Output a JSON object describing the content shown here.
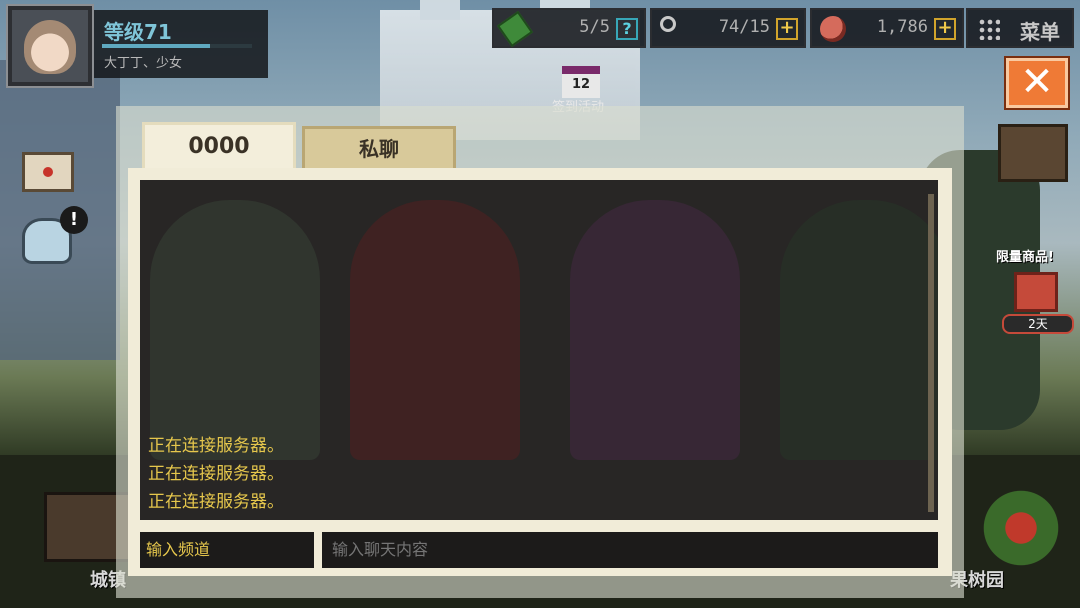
{
  "hud": {
    "level": "等级71",
    "xp_fraction": 0.72,
    "player_name": "大丁丁、少女",
    "resources": {
      "ticket": {
        "value": "5/5",
        "icon": "ticket-icon"
      },
      "key": {
        "value": "74/15",
        "icon": "key-icon"
      },
      "meat": {
        "value": "1,786",
        "icon": "meat-icon"
      }
    },
    "menu_label": "菜单",
    "event": {
      "date": "12",
      "label": "签到活动"
    }
  },
  "side": {
    "mail_icon": "mail-icon",
    "badge": "!",
    "shop_label": "限量商品!",
    "gift_days": "2天"
  },
  "bottom": {
    "left_label": "城镇",
    "right_label": "果树园"
  },
  "chat": {
    "tabs": [
      {
        "label": "0000",
        "active": true
      },
      {
        "label": "私聊",
        "active": false
      }
    ],
    "messages": [
      "正在连接服务器。",
      "正在连接服务器。",
      "正在连接服务器。"
    ],
    "channel_placeholder": "输入频道",
    "message_placeholder": "输入聊天内容"
  },
  "close_icon": "close-icon",
  "colors": {
    "accent_orange": "#ef7a36",
    "chat_text": "#e6c74c",
    "level_text": "#7fc5d8"
  }
}
